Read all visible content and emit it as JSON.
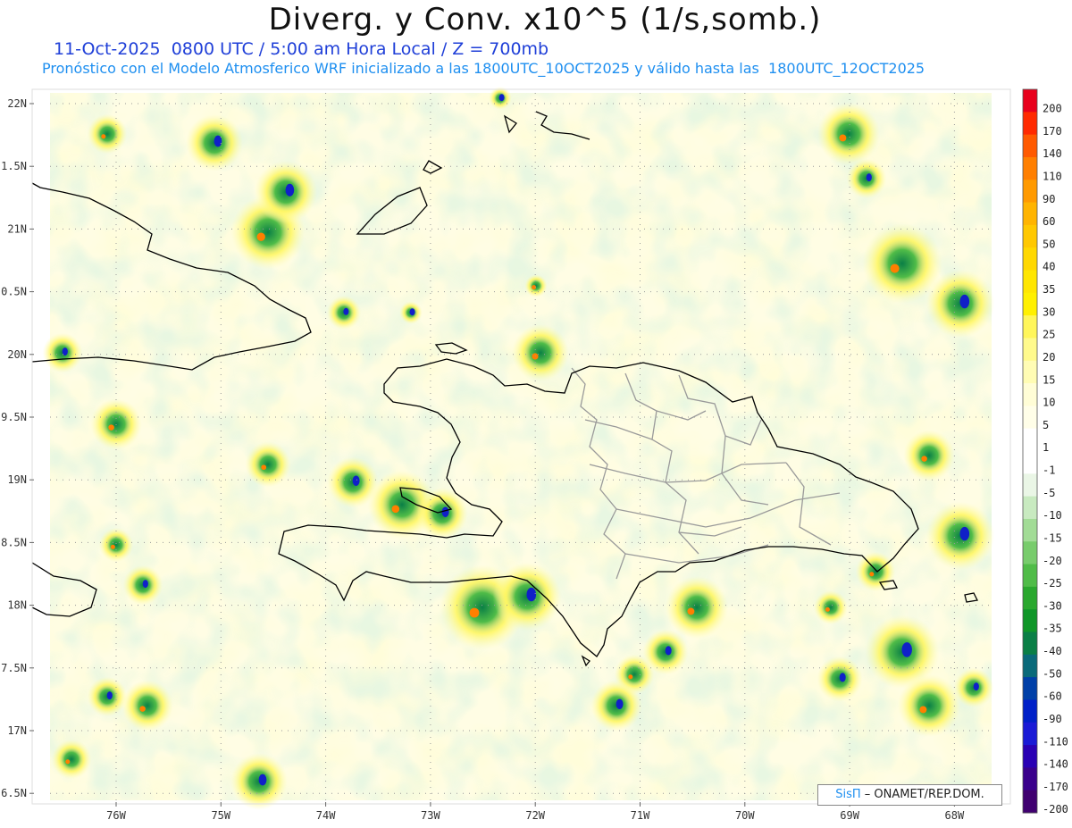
{
  "title": "Diverg. y Conv. x10^5 (1/s,somb.)",
  "subtitle_line1": "11-Oct-2025  0800 UTC / 5:00 am Hora Local / Z = 700mb",
  "subtitle_line2": "Pronóstico con el Modelo Atmosferico WRF inicializado a las 1800UTC_10OCT2025 y válido hasta las  1800UTC_12OCT2025",
  "credit": {
    "brand": "SisΠ",
    "text": "– ONAMET/REP.DOM."
  },
  "lat_labels": [
    "22N",
    "1.5N",
    "21N",
    "0.5N",
    "20N",
    "9.5N",
    "19N",
    "8.5N",
    "18N",
    "7.5N",
    "17N",
    "6.5N"
  ],
  "lon_labels": [
    "76W",
    "75W",
    "74W",
    "73W",
    "72W",
    "71W",
    "70W",
    "69W",
    "68W"
  ],
  "colorbar": {
    "labels": [
      "200",
      "170",
      "140",
      "110",
      "90",
      "60",
      "50",
      "40",
      "35",
      "30",
      "25",
      "20",
      "15",
      "10",
      "5",
      "1",
      "-1",
      "-5",
      "-10",
      "-15",
      "-20",
      "-25",
      "-30",
      "-35",
      "-40",
      "-50",
      "-60",
      "-90",
      "-110",
      "-140",
      "-170",
      "-200"
    ],
    "colors": [
      "#e8001c",
      "#ff2a00",
      "#ff5a00",
      "#ff7f00",
      "#ff9a00",
      "#ffb400",
      "#ffc800",
      "#ffd800",
      "#ffe600",
      "#fff000",
      "#fff65a",
      "#fffa8c",
      "#fffcb4",
      "#fffdd6",
      "#fffee8",
      "#ffffff",
      "#ffffff",
      "#eaf6e6",
      "#c8eac0",
      "#a2dc96",
      "#78cc6c",
      "#50bc48",
      "#2aa82e",
      "#0f9628",
      "#0a7f46",
      "#0a6a7a",
      "#0040a8",
      "#0020c8",
      "#1a1ad6",
      "#2a00b4",
      "#3a008c",
      "#400070"
    ]
  },
  "colors": {
    "title": "#111111",
    "subtitle1": "#1f3fd8",
    "subtitle2": "#1e8ff0",
    "coast": "#000000",
    "provinces": "#999999"
  }
}
